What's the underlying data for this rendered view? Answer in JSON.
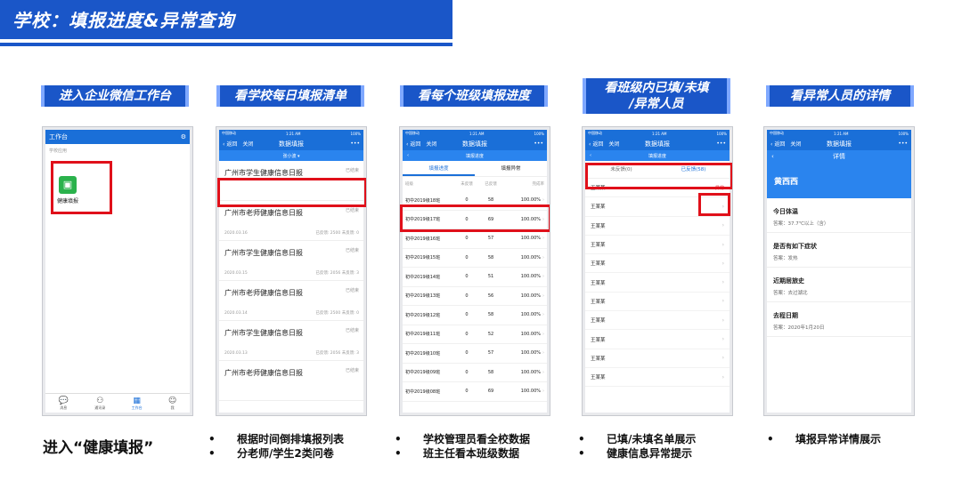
{
  "banner": {
    "title": "学校：填报进度&异常查询"
  },
  "stages": [
    {
      "label": "进入企业微信工作台"
    },
    {
      "label": "看学校每日填报清单"
    },
    {
      "label": "看每个班级填报进度"
    },
    {
      "label": "看班级内已填/未填\n/异常人员"
    },
    {
      "label": "看异常人员的详情"
    }
  ],
  "status": {
    "carrier": "中国移动",
    "time": "1:21 AM",
    "battery": "100%"
  },
  "phone1": {
    "header": "工作台",
    "section": "学校应用",
    "app_label": "健康填报",
    "tabs": [
      "消息",
      "通讯录",
      "工作台",
      "我"
    ]
  },
  "nav": {
    "back": "返回",
    "close": "关闭",
    "title": "数据填报",
    "more": "•••"
  },
  "phone2": {
    "user": "张小波 ▾",
    "items": [
      {
        "title": "广州市学生健康信息日报",
        "tag": "已结束",
        "date": "",
        "stats": ""
      },
      {
        "title": "广州市老师健康信息日报",
        "tag": "已结束",
        "date": "2020.03.16",
        "stats": "已反馈: 2500  未反馈: 0"
      },
      {
        "title": "广州市学生健康信息日报",
        "tag": "已结束",
        "date": "2020.03.15",
        "stats": "已反馈: 2056  未反馈: 3"
      },
      {
        "title": "广州市老师健康信息日报",
        "tag": "已结束",
        "date": "2020.03.14",
        "stats": "已反馈: 2500  未反馈: 0"
      },
      {
        "title": "广州市学生健康信息日报",
        "tag": "已结束",
        "date": "2020.03.13",
        "stats": "已反馈: 2056  未反馈: 3"
      },
      {
        "title": "广州市老师健康信息日报",
        "tag": "已结束",
        "date": "",
        "stats": ""
      }
    ]
  },
  "phone3": {
    "subtitle": "填报进度",
    "tabs": [
      "填报进度",
      "填报异常"
    ],
    "headers": [
      "班级",
      "未反馈",
      "已反馈",
      "完成率"
    ],
    "rows": [
      [
        "初中2019级18班",
        "0",
        "58",
        "100.00%"
      ],
      [
        "初中2019级17班",
        "0",
        "69",
        "100.00%"
      ],
      [
        "初中2019级16班",
        "0",
        "57",
        "100.00%"
      ],
      [
        "初中2019级15班",
        "0",
        "58",
        "100.00%"
      ],
      [
        "初中2019级14班",
        "0",
        "51",
        "100.00%"
      ],
      [
        "初中2019级13班",
        "0",
        "56",
        "100.00%"
      ],
      [
        "初中2019级12班",
        "0",
        "58",
        "100.00%"
      ],
      [
        "初中2019级11班",
        "0",
        "52",
        "100.00%"
      ],
      [
        "初中2019级10班",
        "0",
        "57",
        "100.00%"
      ],
      [
        "初中2019级09班",
        "0",
        "58",
        "100.00%"
      ],
      [
        "初中2019级08班",
        "0",
        "69",
        "100.00%"
      ]
    ]
  },
  "phone4": {
    "subtitle": "填报进度",
    "tabs": [
      "未反馈(0)",
      "已反馈(58)"
    ],
    "person": "王某某",
    "abnormal": "异常",
    "row_count": 11
  },
  "phone5": {
    "subtitle": "详情",
    "name": "黄西西",
    "qa": [
      {
        "q": "今日体温",
        "a": "答案：37.7℃以上（含）"
      },
      {
        "q": "是否有如下症状",
        "a": "答案：发热"
      },
      {
        "q": "近期居旅史",
        "a": "答案：去过湖北"
      },
      {
        "q": "去程日期",
        "a": "答案：2020年1月20日"
      }
    ]
  },
  "captions": {
    "c1": "进入“健康填报”",
    "c2": [
      "根据时间倒排填报列表",
      "分老师/学生2类问卷"
    ],
    "c3": [
      "学校管理员看全校数据",
      "班主任看本班级数据"
    ],
    "c4": [
      "已填/未填名单展示",
      "健康信息异常提示"
    ],
    "c5": [
      "填报异常详情展示"
    ]
  },
  "colors": {
    "brand": "#1a56c8",
    "highlight": "#e0101a",
    "app_icon": "#2bb24c"
  }
}
